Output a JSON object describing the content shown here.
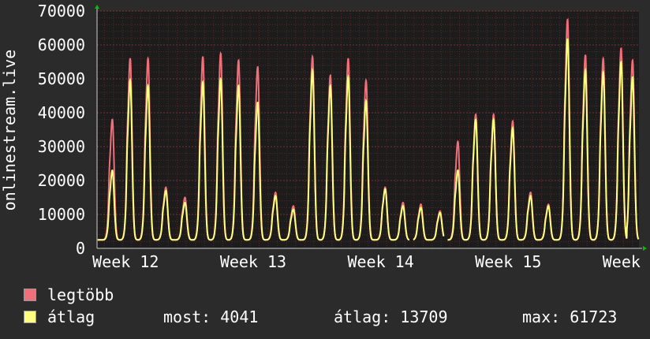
{
  "colors": {
    "background": "#2b2b2b",
    "plot_background": "#1c1c1c",
    "grid_minor": "#5a2626",
    "grid_major": "#7a3030",
    "max_series": "#f0707a",
    "avg_series": "#ffff80",
    "axis_arrow": "#00c000",
    "text": "#ffffff"
  },
  "legend": {
    "max_label": "legtöbb",
    "avg_label": "átlag"
  },
  "stats": {
    "most": "most: 4041",
    "atlag": "átlag: 13709",
    "max": "max: 61723"
  },
  "chart_data": {
    "type": "area",
    "ylabel": "onlinestream.live",
    "ylim": [
      0,
      70000
    ],
    "y_ticks": [
      "0",
      "10000",
      "20000",
      "30000",
      "40000",
      "50000",
      "60000",
      "70000"
    ],
    "x_ticks": [
      "Week 12",
      "Week 13",
      "Week 14",
      "Week 15",
      "Week 16"
    ],
    "x_range_weeks": [
      11.8,
      16.05
    ],
    "gaps_weeks": [
      [
        14.25,
        14.28
      ],
      [
        14.52,
        14.55
      ]
    ],
    "grid": true,
    "daily_peaks": [
      {
        "week": 11.92,
        "max": 38000,
        "avg": 23000
      },
      {
        "week": 12.06,
        "max": 56000,
        "avg": 49500
      },
      {
        "week": 12.2,
        "max": 56000,
        "avg": 48000
      },
      {
        "week": 12.34,
        "max": 18000,
        "avg": 17000
      },
      {
        "week": 12.49,
        "max": 15000,
        "avg": 13500
      },
      {
        "week": 12.63,
        "max": 56500,
        "avg": 49000
      },
      {
        "week": 12.77,
        "max": 57500,
        "avg": 50000
      },
      {
        "week": 12.91,
        "max": 55500,
        "avg": 48000
      },
      {
        "week": 13.06,
        "max": 53500,
        "avg": 43000
      },
      {
        "week": 13.2,
        "max": 16500,
        "avg": 15500
      },
      {
        "week": 13.34,
        "max": 12500,
        "avg": 11500
      },
      {
        "week": 13.49,
        "max": 56500,
        "avg": 52500
      },
      {
        "week": 13.63,
        "max": 51000,
        "avg": 48000
      },
      {
        "week": 13.77,
        "max": 56000,
        "avg": 50500
      },
      {
        "week": 13.91,
        "max": 49500,
        "avg": 43500
      },
      {
        "week": 14.06,
        "max": 18000,
        "avg": 17500
      },
      {
        "week": 14.2,
        "max": 13500,
        "avg": 12500
      },
      {
        "week": 14.34,
        "max": 13000,
        "avg": 12000
      },
      {
        "week": 14.49,
        "max": 11000,
        "avg": 10500
      },
      {
        "week": 14.63,
        "max": 31500,
        "avg": 23000
      },
      {
        "week": 14.77,
        "max": 39500,
        "avg": 38000
      },
      {
        "week": 14.91,
        "max": 39500,
        "avg": 38000
      },
      {
        "week": 15.06,
        "max": 37500,
        "avg": 35500
      },
      {
        "week": 15.2,
        "max": 16500,
        "avg": 15500
      },
      {
        "week": 15.34,
        "max": 13000,
        "avg": 12500
      },
      {
        "week": 15.49,
        "max": 67500,
        "avg": 61723
      },
      {
        "week": 15.63,
        "max": 57000,
        "avg": 52500
      },
      {
        "week": 15.77,
        "max": 56000,
        "avg": 52000
      },
      {
        "week": 15.91,
        "max": 59000,
        "avg": 55000
      },
      {
        "week": 16.0,
        "max": 55500,
        "avg": 50500
      }
    ]
  }
}
